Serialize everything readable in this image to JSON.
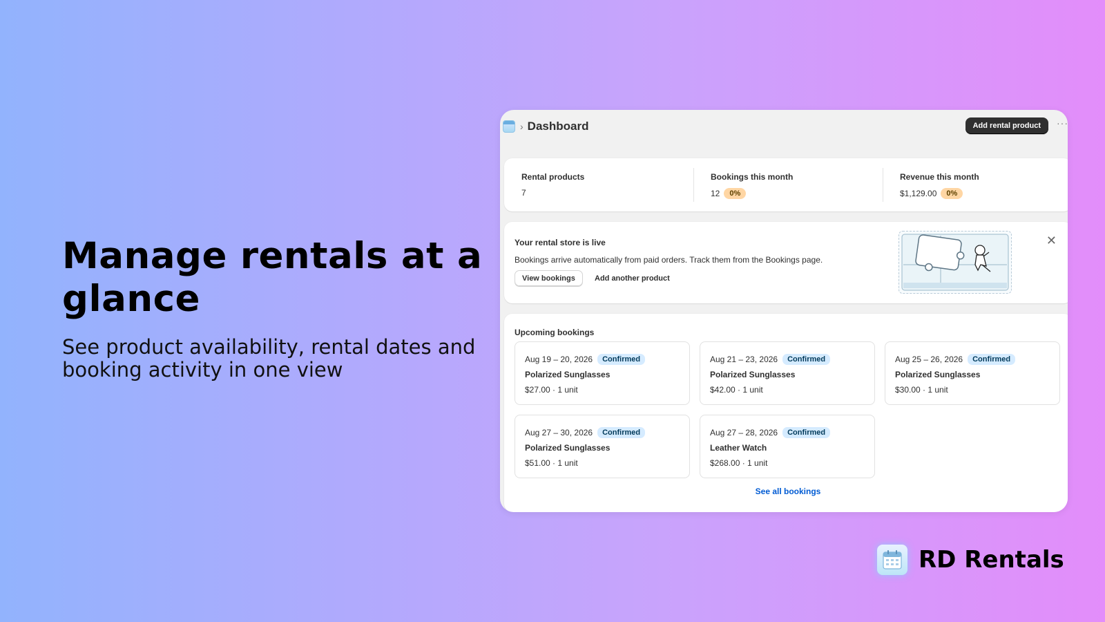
{
  "hero": {
    "title": "Manage rentals at a glance",
    "subtitle": "See product availability, rental dates and booking activity in one view"
  },
  "brand": {
    "name": "RD Rentals",
    "logo_icon": "calendar-icon"
  },
  "app": {
    "breadcrumb_icon": "calendar-icon",
    "page_title": "Dashboard",
    "add_button": "Add rental product",
    "more_icon": "ellipsis-icon",
    "stats": [
      {
        "label": "Rental products",
        "value": "7",
        "badge": ""
      },
      {
        "label": "Bookings this month",
        "value": "12",
        "badge": "0%"
      },
      {
        "label": "Revenue this month",
        "value": "$1,129.00",
        "badge": "0%"
      }
    ],
    "banner": {
      "title": "Your rental store is live",
      "text": "Bookings arrive automatically from paid orders. Track them from the Bookings page.",
      "primary_button": "View bookings",
      "secondary_button": "Add another product",
      "illustration": "puzzle-astronaut-illustration",
      "close_icon": "close-icon"
    },
    "upcoming": {
      "title": "Upcoming bookings",
      "bookings": [
        {
          "dates": "Aug 19 – 20, 2026",
          "status": "Confirmed",
          "product": "Polarized Sunglasses",
          "price": "$27.00 · 1 unit"
        },
        {
          "dates": "Aug 21 – 23, 2026",
          "status": "Confirmed",
          "product": "Polarized Sunglasses",
          "price": "$42.00 · 1 unit"
        },
        {
          "dates": "Aug 25 – 26, 2026",
          "status": "Confirmed",
          "product": "Polarized Sunglasses",
          "price": "$30.00 · 1 unit"
        },
        {
          "dates": "Aug 27 – 30, 2026",
          "status": "Confirmed",
          "product": "Polarized Sunglasses",
          "price": "$51.00 · 1 unit"
        },
        {
          "dates": "Aug 27 – 28, 2026",
          "status": "Confirmed",
          "product": "Leather Watch",
          "price": "$268.00 · 1 unit"
        }
      ],
      "see_all": "See all bookings"
    }
  }
}
